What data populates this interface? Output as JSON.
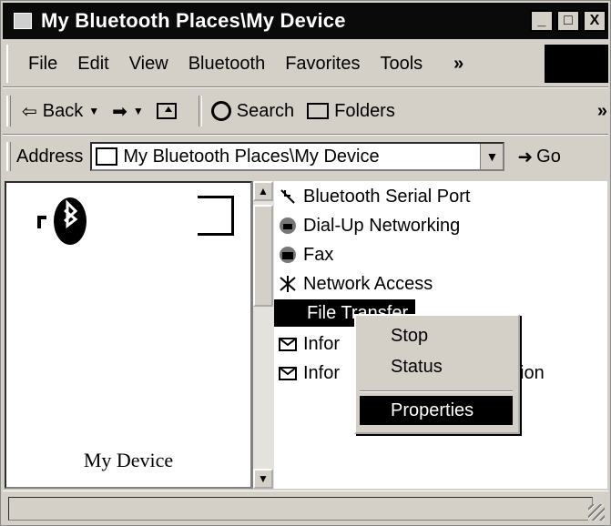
{
  "window": {
    "title": "My Bluetooth Places\\My Device",
    "controls": [
      "_",
      "□",
      "X"
    ]
  },
  "menubar": {
    "items": [
      "File",
      "Edit",
      "View",
      "Bluetooth",
      "Favorites",
      "Tools"
    ],
    "overflow": "»"
  },
  "toolbar": {
    "back": "Back",
    "search": "Search",
    "folders": "Folders",
    "overflow": "»"
  },
  "address": {
    "label": "Address",
    "value": "My Bluetooth Places\\My Device",
    "go": "Go"
  },
  "left_pane": {
    "device_label": "My Device"
  },
  "services": [
    {
      "label": "Bluetooth Serial Port",
      "icon": "serial-port-icon"
    },
    {
      "label": "Dial-Up Networking",
      "icon": "dialup-icon"
    },
    {
      "label": "Fax",
      "icon": "fax-icon"
    },
    {
      "label": "Network Access",
      "icon": "network-icon"
    },
    {
      "label": "File Transfer",
      "icon": "file-transfer-icon"
    },
    {
      "label": "Infor",
      "icon": "info-icon"
    },
    {
      "label": "Infor",
      "icon": "info-sync-icon"
    }
  ],
  "service_tail": "ion",
  "context_menu": {
    "items": [
      "Stop",
      "Status",
      "Properties"
    ]
  },
  "colors": {
    "titlebar": "#0a0a0a",
    "chrome": "#d4d0c8",
    "selection": "#000000"
  }
}
